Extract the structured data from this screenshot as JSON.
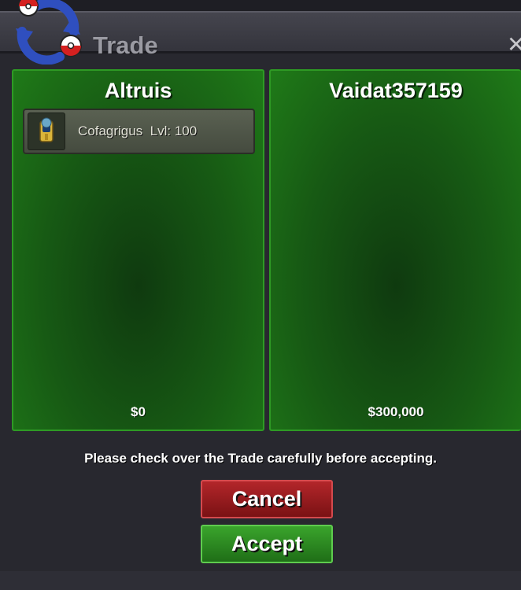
{
  "window": {
    "title": "Trade",
    "close_glyph": "✕"
  },
  "left_panel": {
    "player_name": "Altruis",
    "items": [
      {
        "name": "Cofagrigus",
        "level_text": "Lvl: 100",
        "icon": "cofagrigus-icon"
      }
    ],
    "money": "$0"
  },
  "right_panel": {
    "player_name": "Vaidat357159",
    "items": [],
    "money": "$300,000"
  },
  "notice": "Please check over the Trade carefully before accepting.",
  "buttons": {
    "cancel": "Cancel",
    "accept": "Accept"
  },
  "colors": {
    "panel_green": "#1f7a18",
    "cancel_red": "#b3262a",
    "accept_green": "#3aa42c"
  }
}
